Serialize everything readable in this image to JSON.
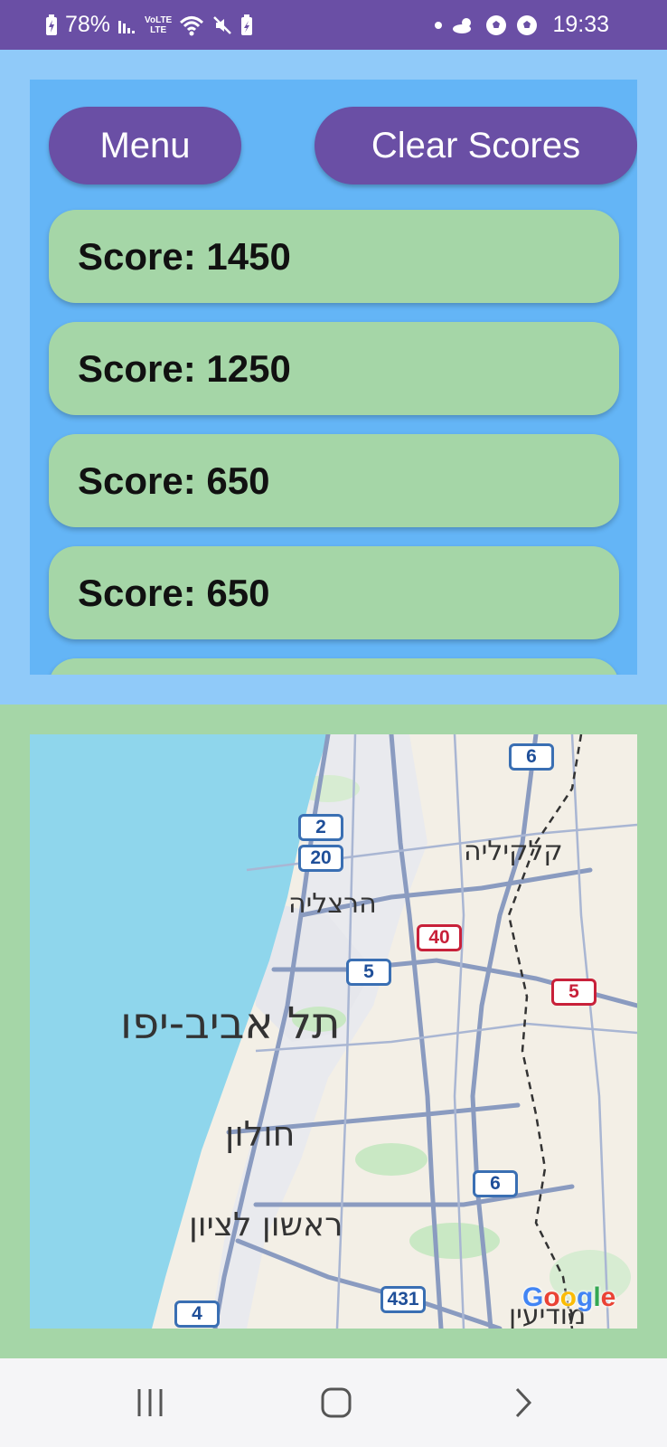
{
  "status_bar": {
    "battery_percent": "78%",
    "lte_label": "LTE",
    "time": "19:33"
  },
  "buttons": {
    "menu_label": "Menu",
    "clear_label": "Clear Scores"
  },
  "scores": [
    {
      "label": "Score: 1450"
    },
    {
      "label": "Score: 1250"
    },
    {
      "label": "Score: 650"
    },
    {
      "label": "Score: 650"
    }
  ],
  "map": {
    "cities": {
      "qalqilya": "קלקיליה",
      "herzliya": "הרצליה",
      "tel_aviv": "תל אביב-יפו",
      "holon": "חולון",
      "rishon": "ראשון לציון",
      "modiin": "מודיעין"
    },
    "road_shields": [
      "6",
      "2",
      "20",
      "40",
      "5",
      "5",
      "6",
      "431",
      "4"
    ],
    "attribution": "Google"
  },
  "colors": {
    "status_bar": "#6a4fa5",
    "top_bg": "#90caf9",
    "panel_bg": "#64b5f6",
    "card_bg": "#a5d6a7",
    "button_bg": "#6a4fa5",
    "map_section_bg": "#a5d6a7",
    "sea": "#8fd6ec"
  },
  "nav": {
    "recents_icon": "recents-icon",
    "home_icon": "home-icon",
    "back_icon": "back-icon"
  }
}
